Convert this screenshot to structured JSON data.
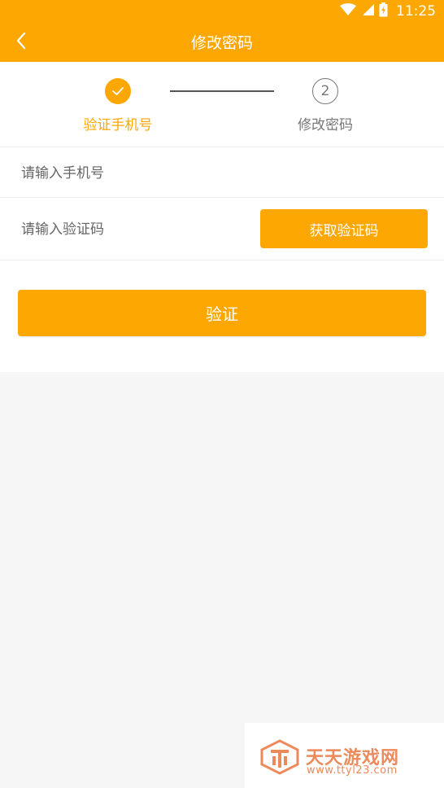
{
  "status_bar": {
    "time": "11:25",
    "icons": [
      "wifi-icon",
      "signal-icon",
      "battery-icon"
    ]
  },
  "nav": {
    "title": "修改密码",
    "back_icon": "chevron-left-icon"
  },
  "steps": [
    {
      "number": "1",
      "label": "验证手机号",
      "state": "completed"
    },
    {
      "number": "2",
      "label": "修改密码",
      "state": "pending"
    }
  ],
  "form": {
    "phone_placeholder": "请输入手机号",
    "code_placeholder": "请输入验证码",
    "get_code_label": "获取验证码",
    "submit_label": "验证"
  },
  "watermark": {
    "title": "天天游戏网",
    "url": "www.ttyl23.com"
  },
  "colors": {
    "accent": "#fda703",
    "background": "#f6f6f6",
    "watermark": "#ec8a5b"
  }
}
